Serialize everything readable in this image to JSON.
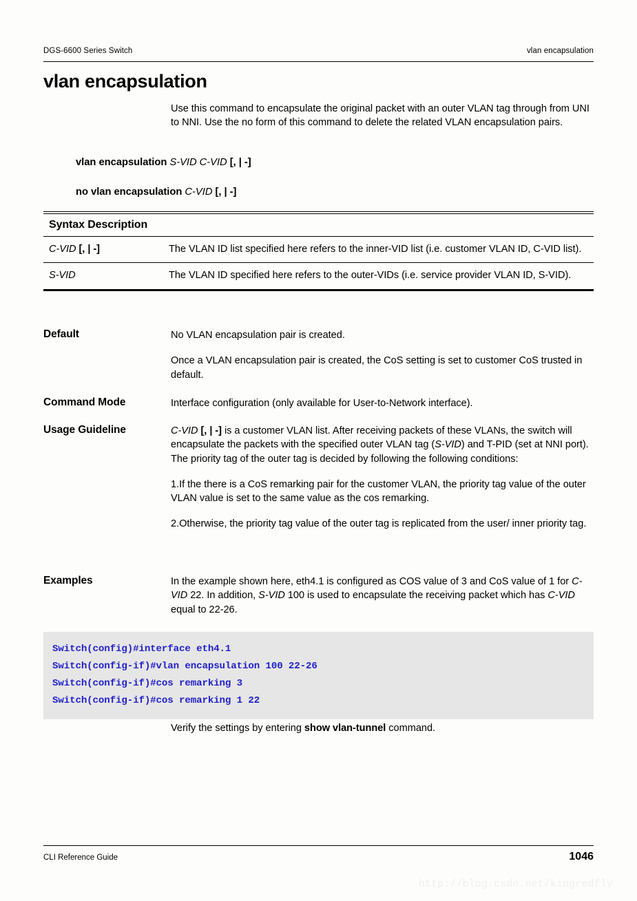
{
  "header": {
    "left": "DGS-6600 Series Switch",
    "right": "vlan encapsulation"
  },
  "title": "vlan encapsulation",
  "intro": "Use this command to encapsulate the original packet with an outer VLAN tag through from UNI to NNI. Use the no form of this command to delete the related VLAN encapsulation pairs.",
  "syntax": {
    "line1_cmd": "vlan encapsulation",
    "line1_args_italic": "S-VID C-VID",
    "line1_args_bold": "[, | -]",
    "line2_cmd": "no vlan encapsulation",
    "line2_args_italic": "C-VID",
    "line2_args_bold": "[, | -]"
  },
  "syntax_description": {
    "heading": "Syntax Description",
    "rows": [
      {
        "term_italic": "C-VID",
        "term_bold": "[, | -]",
        "description": "The VLAN ID list specified here refers to the inner-VID list (i.e. customer VLAN ID, C-VID list)."
      },
      {
        "term_italic": "S-VID",
        "term_bold": "",
        "description": "The VLAN ID specified here refers to the outer-VIDs (i.e. service provider VLAN ID, S-VID)."
      }
    ]
  },
  "default": {
    "label": "Default",
    "para1": "No VLAN encapsulation pair is created.",
    "para2": "Once a VLAN encapsulation pair is created, the CoS setting is set to customer CoS trusted in default."
  },
  "command_mode": {
    "label": "Command Mode",
    "text": "Interface configuration (only available for User-to-Network interface)."
  },
  "usage_guideline": {
    "label": "Usage Guideline",
    "para1_a": "C-VID",
    "para1_b": "[, | -]",
    "para1_c": " is a customer VLAN list. After receiving packets of these VLANs, the switch will encapsulate the packets with the specified outer VLAN tag (",
    "para1_d": "S-VID",
    "para1_e": ") and T-PID (set at NNI port). The priority tag of the outer tag is decided by following the following conditions:",
    "para2": "1.If the there is a CoS remarking pair for the customer VLAN, the priority tag value of the outer VLAN value is set to the same value as the cos remarking.",
    "para3": "2.Otherwise, the priority tag value of the outer tag is replicated from the user/ inner priority tag."
  },
  "examples": {
    "label": "Examples",
    "text_a": "In the example shown here, eth4.1 is configured as COS value of 3 and CoS value of 1 for ",
    "text_b": "C-VID",
    "text_c": " 22. In addition, ",
    "text_d": "S-VID",
    "text_e": " 100 is used to encapsulate the receiving packet which has ",
    "text_f": "C-VID",
    "text_g": " equal to 22-26."
  },
  "code": {
    "lines": [
      "Switch(config)#interface eth4.1",
      "Switch(config-if)#vlan encapsulation 100 22-26",
      "Switch(config-if)#cos remarking 3",
      "Switch(config-if)#cos remarking 1 22"
    ],
    "color": "#1f1fcc",
    "background": "#e6e6e6"
  },
  "verify": {
    "prefix": "Verify the settings by entering ",
    "command": "show vlan-tunnel",
    "suffix": " command."
  },
  "footer": {
    "left": "CLI Reference Guide",
    "page": "1046"
  },
  "watermark": "http://blog.csdn.net/kingredfly"
}
